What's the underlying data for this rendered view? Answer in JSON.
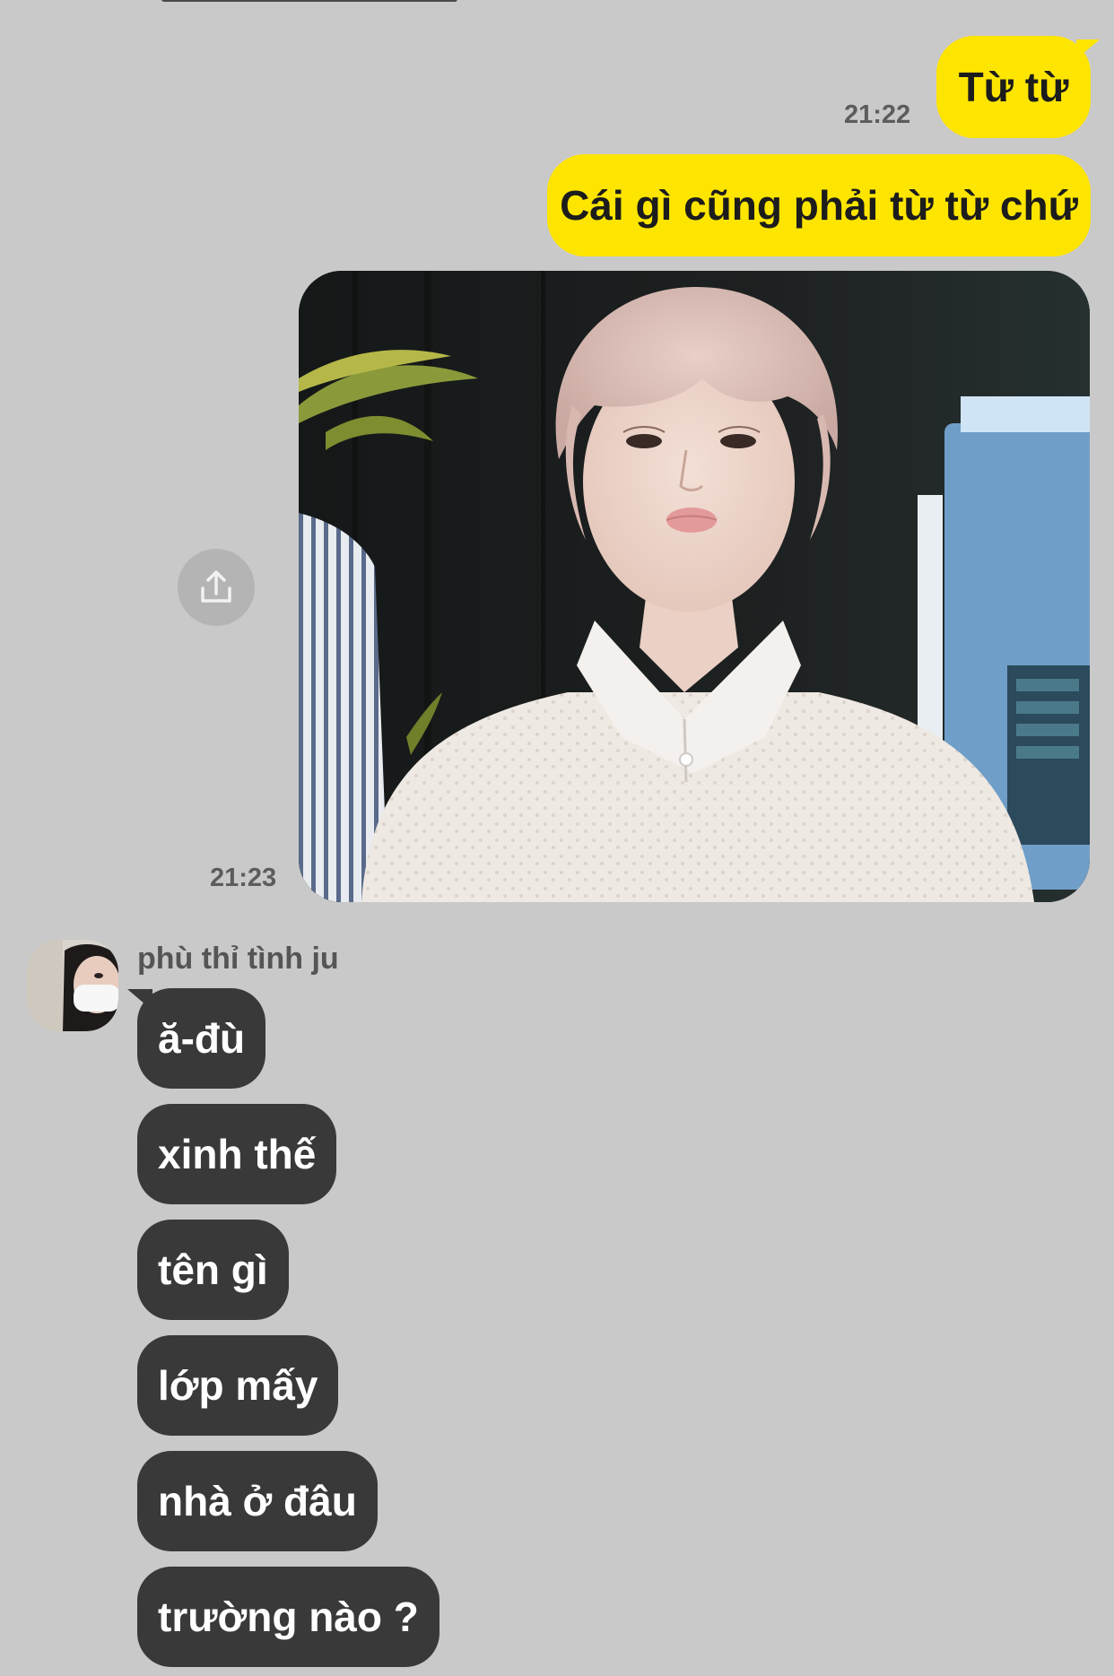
{
  "outgoing": [
    {
      "text": "Từ từ",
      "time": "21:22"
    },
    {
      "text": "Cái gì cũng phải từ từ chứ"
    }
  ],
  "photo_message": {
    "time": "21:23"
  },
  "share_icon": "share-upload-icon",
  "incoming": {
    "sender_name": "phù thỉ tình ju",
    "avatar_icon": "avatar-masked-person",
    "messages": [
      "ă-đù",
      "xinh thế",
      "tên gì",
      "lớp mấy",
      "nhà ở đâu",
      "trường nào ?"
    ]
  },
  "colors": {
    "background": "#c9c9c9",
    "outgoing_bubble": "#fee500",
    "incoming_bubble": "#393939",
    "timestamp": "#5c5c5c"
  }
}
